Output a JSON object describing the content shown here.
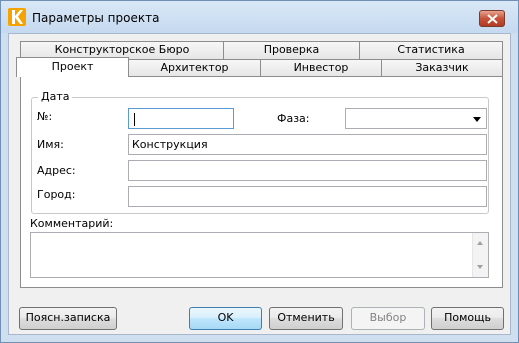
{
  "window": {
    "title": "Параметры проекта",
    "icon": "app-logo-icon",
    "close_icon": "close-icon"
  },
  "tabs": {
    "row_back": [
      {
        "label": "Конструкторское Бюро"
      },
      {
        "label": "Проверка"
      },
      {
        "label": "Статистика"
      }
    ],
    "row_front": [
      {
        "label": "Проект",
        "active": true
      },
      {
        "label": "Архитектор"
      },
      {
        "label": "Инвестор"
      },
      {
        "label": "Заказчик"
      }
    ]
  },
  "form": {
    "group_label": "Дата",
    "number": {
      "label": "№:",
      "value": ""
    },
    "phase": {
      "label": "Фаза:",
      "value": ""
    },
    "name": {
      "label": "Имя:",
      "value": "Конструкция"
    },
    "address": {
      "label": "Адрес:",
      "value": ""
    },
    "city": {
      "label": "Город:",
      "value": ""
    },
    "comment": {
      "label": "Комментарий:",
      "value": ""
    }
  },
  "buttons": {
    "note": "Поясн.записка",
    "ok": "OK",
    "cancel": "Отменить",
    "select": "Выбор",
    "help": "Помощь"
  },
  "colors": {
    "frame": "#cfdff0",
    "close": "#c8523a",
    "default_button": "#bee6fd"
  }
}
